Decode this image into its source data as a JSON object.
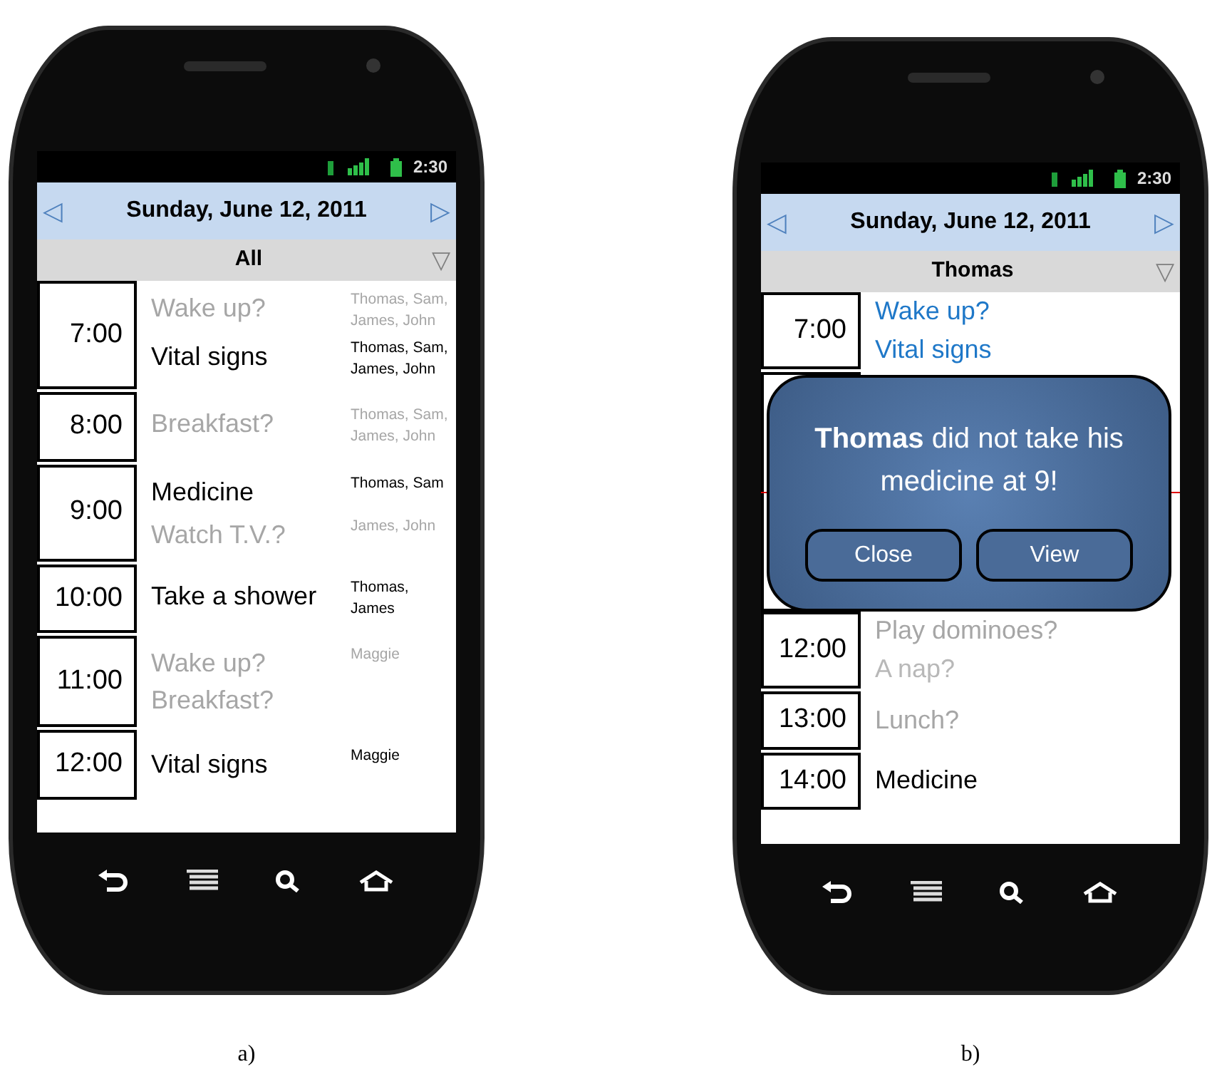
{
  "screens": [
    {
      "caption": "a)",
      "status_time": "2:30",
      "prev": "◁",
      "date": "Sunday, June 12, 2011",
      "next": "▷",
      "filter": "All",
      "filter_arrow": "▽",
      "slots": [
        {
          "time": "7:00",
          "events": [
            {
              "title": "Wake up?",
              "people": "Thomas, Sam, James, John",
              "kind": "tentative"
            },
            {
              "title": "Vital signs",
              "people": "Thomas, Sam, James, John",
              "kind": "confirmed"
            }
          ]
        },
        {
          "time": "8:00",
          "events": [
            {
              "title": "Breakfast?",
              "people": "Thomas, Sam, James, John",
              "kind": "tentative"
            }
          ]
        },
        {
          "time": "9:00",
          "events": [
            {
              "title": "Medicine",
              "people": "Thomas, Sam",
              "kind": "confirmed"
            },
            {
              "title": "Watch T.V.?",
              "people": "James, John",
              "kind": "tentative"
            }
          ]
        },
        {
          "time": "10:00",
          "events": [
            {
              "title": "Take a shower",
              "people": "Thomas, James",
              "kind": "confirmed"
            }
          ]
        },
        {
          "time": "11:00",
          "events": [
            {
              "title": "Wake up? Breakfast?",
              "people": "Maggie",
              "kind": "tentative"
            }
          ]
        },
        {
          "time": "12:00",
          "events": [
            {
              "title": "Vital signs",
              "people": "Maggie",
              "kind": "confirmed"
            }
          ]
        }
      ]
    },
    {
      "caption": "b)",
      "status_time": "2:30",
      "prev": "◁",
      "date": "Sunday, June 12, 2011",
      "next": "▷",
      "filter": "Thomas",
      "filter_arrow": "▽",
      "slots": [
        {
          "time": "7:00",
          "events": [
            {
              "title": "Wake up?",
              "kind": "completed"
            },
            {
              "title": "Vital signs",
              "kind": "completed"
            }
          ]
        }
      ],
      "dialog": {
        "message": "**Thomas** did not take his medicine at 9!",
        "buttons": [
          "Close",
          "View"
        ]
      },
      "slots_below_dialog": [
        {
          "time": "12:00",
          "events": [
            {
              "title": "Play dominoes?",
              "kind": "tentative"
            },
            {
              "title": "A nap?",
              "kind": "faded"
            }
          ]
        },
        {
          "time": "13:00",
          "events": [
            {
              "title": "Lunch?",
              "kind": "tentative"
            }
          ]
        },
        {
          "time": "14:00",
          "events": [
            {
              "title": "Medicine",
              "kind": "confirmed"
            }
          ]
        }
      ]
    }
  ]
}
